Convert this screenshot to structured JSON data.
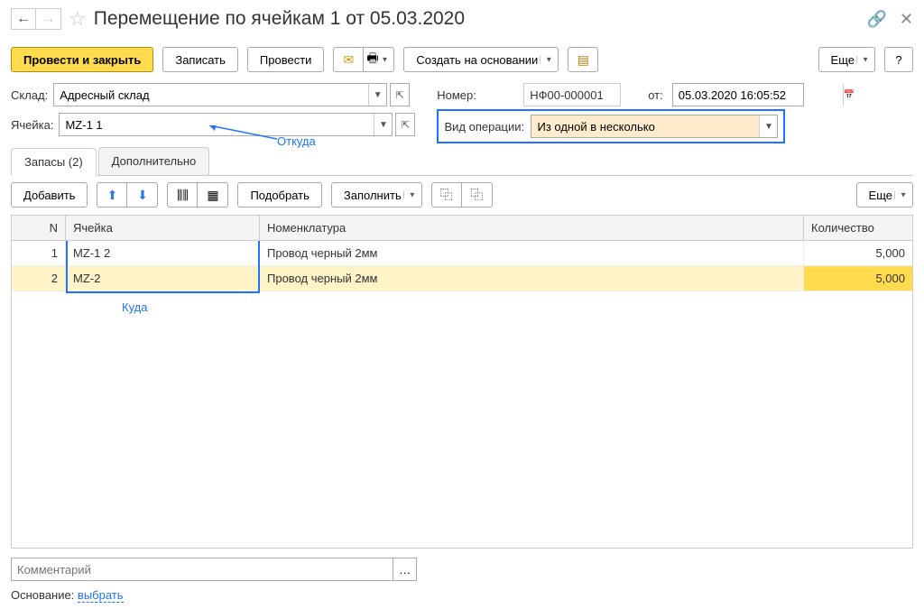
{
  "header": {
    "title": "Перемещение по ячейкам 1 от 05.03.2020"
  },
  "toolbar": {
    "post_close": "Провести и закрыть",
    "save": "Записать",
    "post": "Провести",
    "create_based": "Создать на основании",
    "more": "Еще",
    "help": "?"
  },
  "form": {
    "warehouse_label": "Склад:",
    "warehouse_value": "Адресный склад",
    "cell_label": "Ячейка:",
    "cell_value": "MZ-1 1",
    "number_label": "Номер:",
    "number_value": "НФ00-000001",
    "date_label": "от:",
    "date_value": "05.03.2020 16:05:52",
    "optype_label": "Вид операции:",
    "optype_value": "Из одной в несколько",
    "note_from": "Откуда"
  },
  "tabs": {
    "stock": "Запасы (2)",
    "extra": "Дополнительно"
  },
  "grid_toolbar": {
    "add": "Добавить",
    "pick": "Подобрать",
    "fill": "Заполнить",
    "more": "Еще"
  },
  "grid": {
    "headers": {
      "n": "N",
      "cell": "Ячейка",
      "nom": "Номенклатура",
      "qty": "Количество"
    },
    "rows": [
      {
        "n": "1",
        "cell": "MZ-1 2",
        "nom": "Провод черный 2мм",
        "qty": "5,000"
      },
      {
        "n": "2",
        "cell": "MZ-2",
        "nom": "Провод черный 2мм",
        "qty": "5,000"
      }
    ],
    "note_to": "Куда"
  },
  "footer": {
    "comment_placeholder": "Комментарий",
    "basis_label": "Основание:",
    "basis_link": "выбрать"
  }
}
